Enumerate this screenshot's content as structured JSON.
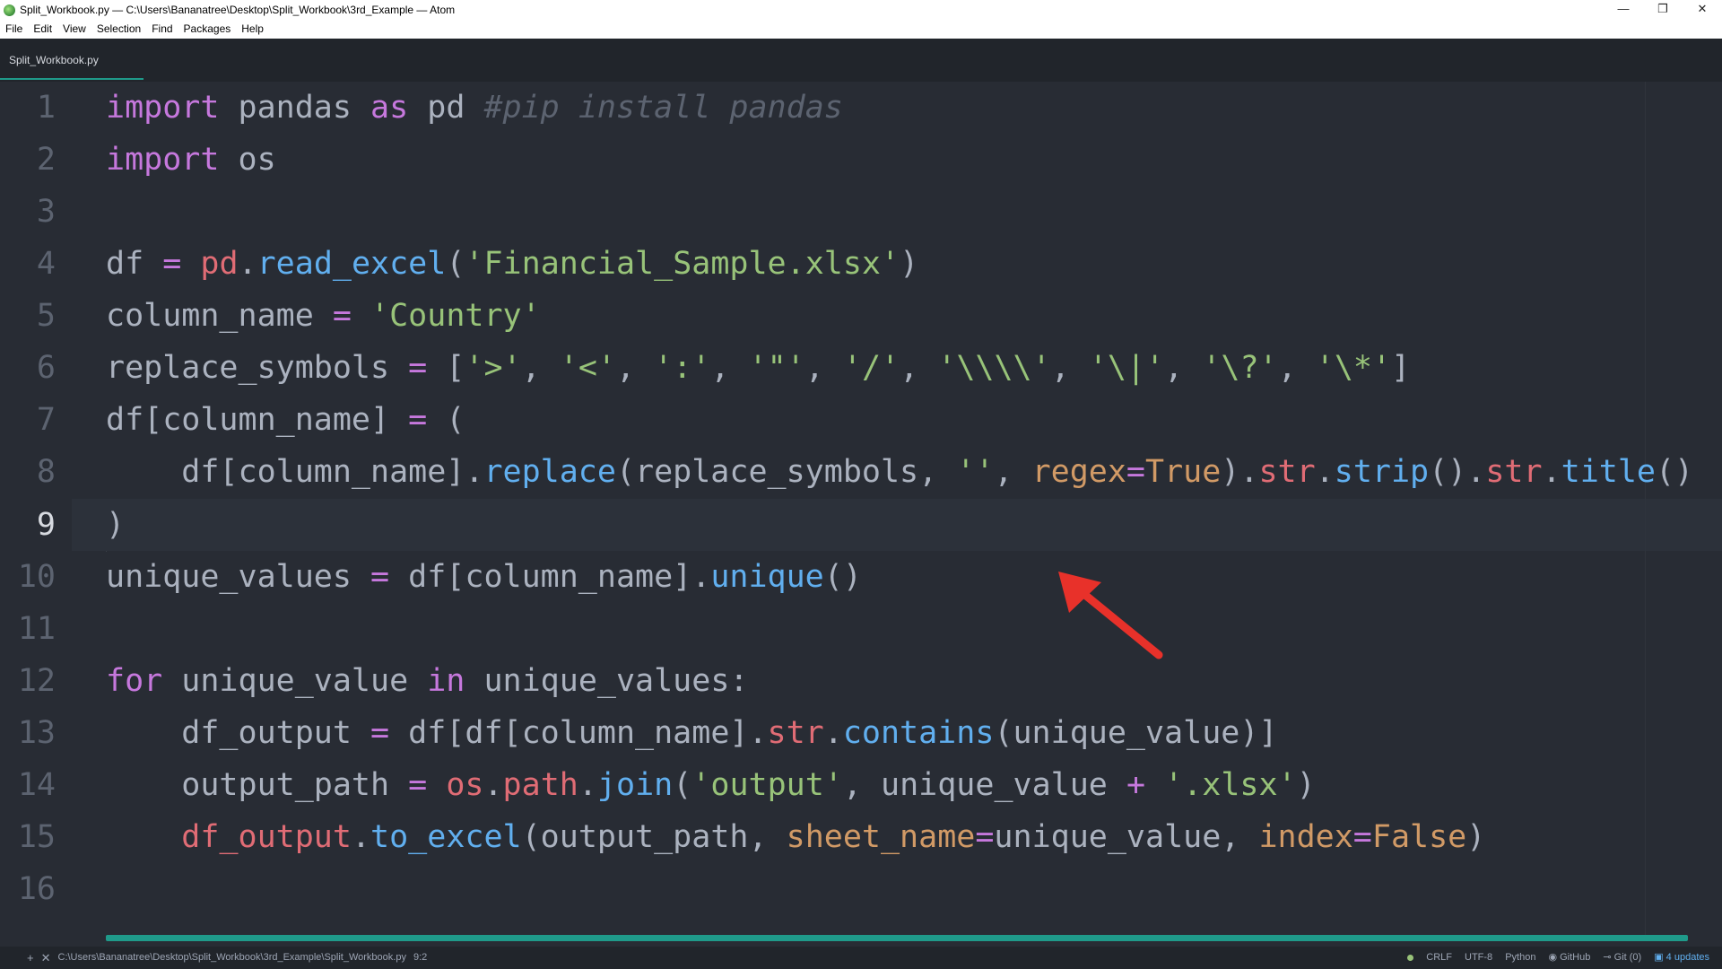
{
  "window": {
    "title": "Split_Workbook.py — C:\\Users\\Bananatree\\Desktop\\Split_Workbook\\3rd_Example — Atom",
    "minimize": "—",
    "restore": "❐",
    "close": "✕"
  },
  "menu": [
    "File",
    "Edit",
    "View",
    "Selection",
    "Find",
    "Packages",
    "Help"
  ],
  "tab": {
    "label": "Split_Workbook.py"
  },
  "editor": {
    "line_numbers": [
      "1",
      "2",
      "3",
      "4",
      "5",
      "6",
      "7",
      "8",
      "9",
      "10",
      "11",
      "12",
      "13",
      "14",
      "15",
      "16"
    ],
    "cursor_line": "9",
    "tokens": {
      "l1": [
        "import",
        " pandas ",
        "as",
        " pd ",
        "#pip install pandas"
      ],
      "l2": [
        "import",
        " os"
      ],
      "l4": [
        "df ",
        "=",
        " ",
        "pd",
        ".",
        "read_excel",
        "(",
        "'Financial_Sample.xlsx'",
        ")"
      ],
      "l5": [
        "column_name ",
        "=",
        " ",
        "'Country'"
      ],
      "l6": [
        "replace_symbols ",
        "=",
        " [",
        "'>'",
        ", ",
        "'<'",
        ", ",
        "':'",
        ", ",
        "'\"'",
        ", ",
        "'/'",
        ", ",
        "'\\\\\\\\'",
        ", ",
        "'\\|'",
        ", ",
        "'\\?'",
        ", ",
        "'\\*'",
        "]"
      ],
      "l7": [
        "df[column_name] ",
        "=",
        " ("
      ],
      "l8": [
        "    df[column_name].",
        "replace",
        "(replace_symbols, ",
        "''",
        ", ",
        "regex",
        "=",
        "True",
        ").",
        "str",
        ".",
        "strip",
        "().",
        "str",
        ".",
        "title",
        "()"
      ],
      "l9": [
        ")"
      ],
      "l10": [
        "unique_values ",
        "=",
        " df[column_name].",
        "unique",
        "()"
      ],
      "l12": [
        "for",
        " unique_value ",
        "in",
        " unique_values:"
      ],
      "l13": [
        "    df_output ",
        "=",
        " df[df[column_name].",
        "str",
        ".",
        "contains",
        "(unique_value)]"
      ],
      "l14": [
        "    output_path ",
        "=",
        " ",
        "os",
        ".",
        "path",
        ".",
        "join",
        "(",
        "'output'",
        ", unique_value ",
        "+",
        " ",
        "'.xlsx'",
        ")"
      ],
      "l15": [
        "    ",
        "df_output",
        ".",
        "to_excel",
        "(output_path, ",
        "sheet_name",
        "=",
        "unique_value, ",
        "index",
        "=",
        "False",
        ")"
      ]
    }
  },
  "status": {
    "add": "+",
    "close": "✕",
    "path": "C:\\Users\\Bananatree\\Desktop\\Split_Workbook\\3rd_Example\\Split_Workbook.py",
    "cursor_pos": "9:2",
    "line_ending": "CRLF",
    "encoding": "UTF-8",
    "grammar": "Python",
    "github": "GitHub",
    "git": "Git (0)",
    "updates": "4 updates"
  },
  "colors": {
    "background": "#282c34",
    "keyword": "#c678dd",
    "string": "#98c379",
    "function": "#61afef",
    "variable": "#e06c75",
    "parameter": "#d19a66",
    "comment": "#5c6370",
    "accent": "#1f9a8a",
    "annotation_arrow": "#e8312a"
  },
  "icons": {
    "app": "atom-logo-icon",
    "status_github": "github-icon",
    "status_git": "git-commit-icon",
    "status_updates": "package-icon"
  }
}
